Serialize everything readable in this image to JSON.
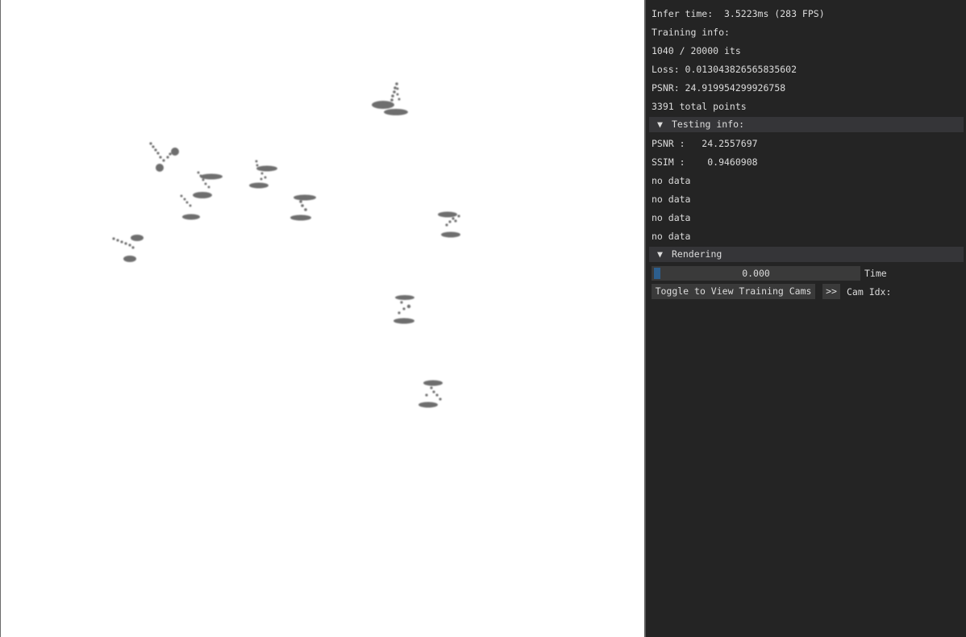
{
  "panel": {
    "infer_time": "Infer time:  3.5223ms (283 FPS)",
    "training_info": "Training info:",
    "iterations": "1040 / 20000 its",
    "loss": "Loss: 0.013043826565835602",
    "psnr_train": "PSNR: 24.919954299926758",
    "total_points": "3391 total points",
    "testing_header": "Testing info:",
    "testing_arrow": "▼",
    "psnr_test": "PSNR :   24.2557697",
    "ssim_test": "SSIM :    0.9460908",
    "no_data": [
      "no data",
      "no data",
      "no data",
      "no data"
    ],
    "rendering_header": "Rendering",
    "rendering_arrow": "▼",
    "time_value": "0.000",
    "time_label": "Time",
    "time_fraction": 0,
    "toggle_button": "Toggle to View Training Cams",
    "next_button": ">>",
    "cam_idx_label": "Cam Idx:"
  },
  "colors": {
    "panel_bg": "#242424",
    "header_bg": "#353538",
    "text": "#dcdcdc",
    "slider_grab": "#2d5f8e",
    "splat": "#6e6e6e"
  }
}
